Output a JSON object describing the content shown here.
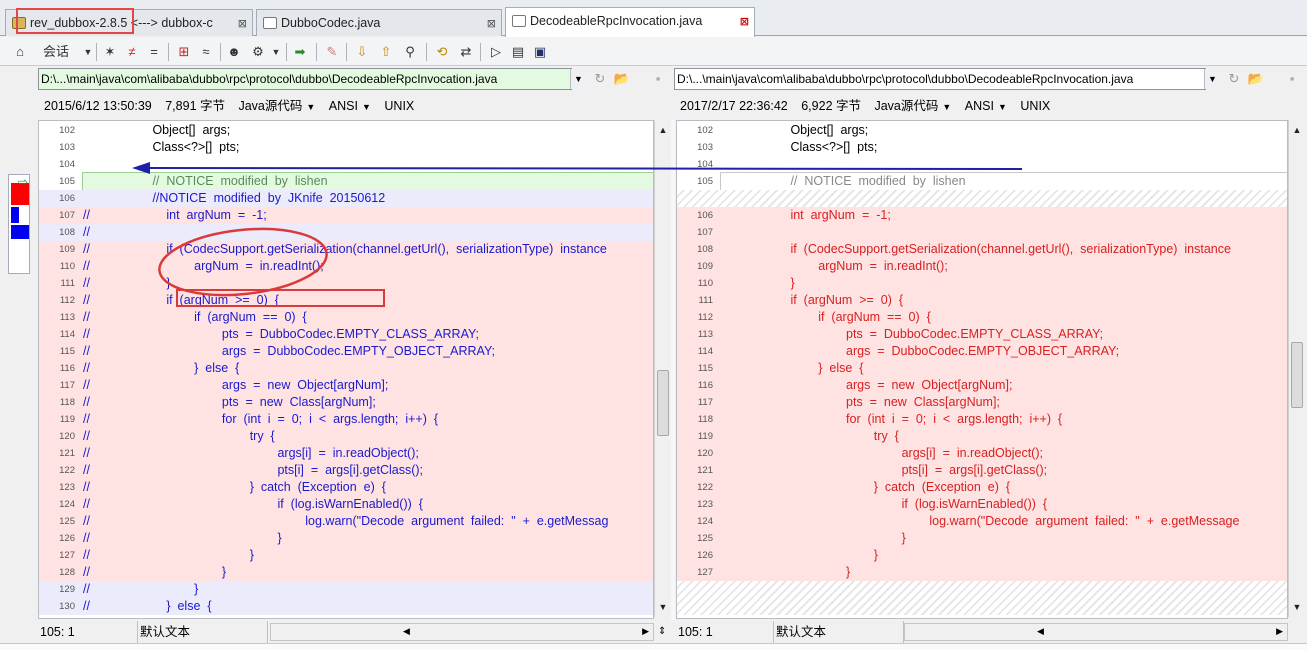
{
  "tabs": [
    {
      "label": "rev_dubbox-2.8.5 <---> dubbox-c",
      "active": false
    },
    {
      "label": "DubboCodec.java",
      "active": false
    },
    {
      "label": "DecodeableRpcInvocation.java",
      "active": true
    }
  ],
  "toolbar": {
    "session_label": "会话"
  },
  "left": {
    "path": "D:\\...\\main\\java\\com\\alibaba\\dubbo\\rpc\\protocol\\dubbo\\DecodeableRpcInvocation.java",
    "date": "2015/6/12 13:50:39",
    "size": "7,891 字节",
    "format": "Java源代码",
    "encoding": "ANSI",
    "eol": "UNIX",
    "lines": [
      {
        "n": "102",
        "t": "                    Object[]  args;",
        "c": "plain"
      },
      {
        "n": "103",
        "t": "                    Class<?>[]  pts;",
        "c": "plain"
      },
      {
        "n": "104",
        "t": "",
        "c": "plain"
      },
      {
        "n": "105",
        "t": "                    //  NOTICE  modified  by  lishen",
        "c": "green"
      },
      {
        "n": "106",
        "t": "                    //NOTICE  modified  by  JKnife  20150612",
        "c": "blue"
      },
      {
        "n": "107",
        "t": "//                      int  argNum  =  -1;",
        "c": "red"
      },
      {
        "n": "108",
        "t": "//",
        "c": "blue"
      },
      {
        "n": "109",
        "t": "//                      if  (CodecSupport.getSerialization(channel.getUrl(),  serializationType)  instance",
        "c": "red"
      },
      {
        "n": "110",
        "t": "//                              argNum  =  in.readInt();",
        "c": "red"
      },
      {
        "n": "111",
        "t": "//                      }",
        "c": "red"
      },
      {
        "n": "112",
        "t": "//                      if  (argNum  >=  0)  {",
        "c": "red"
      },
      {
        "n": "113",
        "t": "//                              if  (argNum  ==  0)  {",
        "c": "red"
      },
      {
        "n": "114",
        "t": "//                                      pts  =  DubboCodec.EMPTY_CLASS_ARRAY;",
        "c": "red"
      },
      {
        "n": "115",
        "t": "//                                      args  =  DubboCodec.EMPTY_OBJECT_ARRAY;",
        "c": "red"
      },
      {
        "n": "116",
        "t": "//                              }  else  {",
        "c": "red"
      },
      {
        "n": "117",
        "t": "//                                      args  =  new  Object[argNum];",
        "c": "red"
      },
      {
        "n": "118",
        "t": "//                                      pts  =  new  Class[argNum];",
        "c": "red"
      },
      {
        "n": "119",
        "t": "//                                      for  (int  i  =  0;  i  <  args.length;  i++)  {",
        "c": "red"
      },
      {
        "n": "120",
        "t": "//                                              try  {",
        "c": "red"
      },
      {
        "n": "121",
        "t": "//                                                      args[i]  =  in.readObject();",
        "c": "red"
      },
      {
        "n": "122",
        "t": "//                                                      pts[i]  =  args[i].getClass();",
        "c": "red"
      },
      {
        "n": "123",
        "t": "//                                              }  catch  (Exception  e)  {",
        "c": "red"
      },
      {
        "n": "124",
        "t": "//                                                      if  (log.isWarnEnabled())  {",
        "c": "red"
      },
      {
        "n": "125",
        "t": "//                                                              log.warn(\"Decode  argument  failed:  \"  +  e.getMessag",
        "c": "red"
      },
      {
        "n": "126",
        "t": "//                                                      }",
        "c": "red"
      },
      {
        "n": "127",
        "t": "//                                              }",
        "c": "red"
      },
      {
        "n": "128",
        "t": "//                                      }",
        "c": "red"
      },
      {
        "n": "129",
        "t": "//                              }",
        "c": "blue"
      },
      {
        "n": "130",
        "t": "//                      }  else  {",
        "c": "blue"
      }
    ]
  },
  "right": {
    "path": "D:\\...\\main\\java\\com\\alibaba\\dubbo\\rpc\\protocol\\dubbo\\DecodeableRpcInvocation.java",
    "date": "2017/2/17 22:36:42",
    "size": "6,922 字节",
    "format": "Java源代码",
    "encoding": "ANSI",
    "eol": "UNIX",
    "lines": [
      {
        "n": "102",
        "t": "                    Object[]  args;",
        "c": "plain"
      },
      {
        "n": "103",
        "t": "                    Class<?>[]  pts;",
        "c": "plain"
      },
      {
        "n": "104",
        "t": "",
        "c": "plain"
      },
      {
        "n": "105",
        "t": "                    //  NOTICE  modified  by  lishen",
        "c": "ignored"
      },
      {
        "n": "",
        "t": "",
        "c": "hatch"
      },
      {
        "n": "106",
        "t": "                    int  argNum  =  -1;",
        "c": "red"
      },
      {
        "n": "107",
        "t": "",
        "c": "red"
      },
      {
        "n": "108",
        "t": "                    if  (CodecSupport.getSerialization(channel.getUrl(),  serializationType)  instance",
        "c": "red"
      },
      {
        "n": "109",
        "t": "                            argNum  =  in.readInt();",
        "c": "red"
      },
      {
        "n": "110",
        "t": "                    }",
        "c": "red"
      },
      {
        "n": "111",
        "t": "                    if  (argNum  >=  0)  {",
        "c": "red"
      },
      {
        "n": "112",
        "t": "                            if  (argNum  ==  0)  {",
        "c": "red"
      },
      {
        "n": "113",
        "t": "                                    pts  =  DubboCodec.EMPTY_CLASS_ARRAY;",
        "c": "red"
      },
      {
        "n": "114",
        "t": "                                    args  =  DubboCodec.EMPTY_OBJECT_ARRAY;",
        "c": "red"
      },
      {
        "n": "115",
        "t": "                            }  else  {",
        "c": "red"
      },
      {
        "n": "116",
        "t": "                                    args  =  new  Object[argNum];",
        "c": "red"
      },
      {
        "n": "117",
        "t": "                                    pts  =  new  Class[argNum];",
        "c": "red"
      },
      {
        "n": "118",
        "t": "                                    for  (int  i  =  0;  i  <  args.length;  i++)  {",
        "c": "red"
      },
      {
        "n": "119",
        "t": "                                            try  {",
        "c": "red"
      },
      {
        "n": "120",
        "t": "                                                    args[i]  =  in.readObject();",
        "c": "red"
      },
      {
        "n": "121",
        "t": "                                                    pts[i]  =  args[i].getClass();",
        "c": "red"
      },
      {
        "n": "122",
        "t": "                                            }  catch  (Exception  e)  {",
        "c": "red"
      },
      {
        "n": "123",
        "t": "                                                    if  (log.isWarnEnabled())  {",
        "c": "red"
      },
      {
        "n": "124",
        "t": "                                                            log.warn(\"Decode  argument  failed:  \"  +  e.getMessage",
        "c": "red"
      },
      {
        "n": "125",
        "t": "                                                    }",
        "c": "red"
      },
      {
        "n": "126",
        "t": "                                            }",
        "c": "red"
      },
      {
        "n": "127",
        "t": "                                    }",
        "c": "red"
      },
      {
        "n": "",
        "t": "",
        "c": "hatch"
      },
      {
        "n": "",
        "t": "",
        "c": "hatch"
      }
    ]
  },
  "status": {
    "left_pos": "105: 1",
    "left_mode": "默认文本",
    "right_pos": "105: 1",
    "right_mode": "默认文本"
  },
  "colors": {
    "annotation_red": "#d93a3a",
    "arrow_blue": "#1f1fa8"
  }
}
